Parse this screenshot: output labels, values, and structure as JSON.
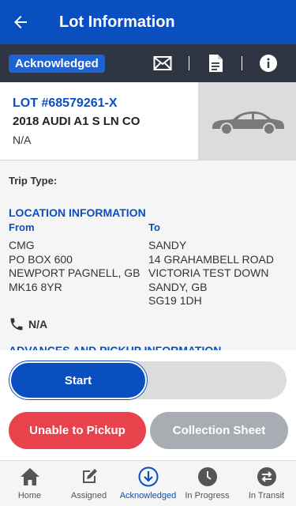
{
  "header": {
    "title": "Lot Information",
    "back_icon": "arrow-left-icon"
  },
  "status_bar": {
    "badge": "Acknowledged",
    "icons": [
      "mail-icon",
      "document-icon",
      "info-icon"
    ]
  },
  "lot": {
    "number": "LOT #68579261-X",
    "vehicle": "2018 AUDI A1 S LN CO",
    "secondary": "N/A",
    "image_icon": "car-icon"
  },
  "details": {
    "trip_type_label": "Trip Type:",
    "location_heading": "LOCATION INFORMATION",
    "from": {
      "label": "From",
      "lines": [
        "CMG",
        "PO BOX 600",
        "NEWPORT PAGNELL, GB",
        "MK16 8YR"
      ]
    },
    "to": {
      "label": "To",
      "lines": [
        "SANDY",
        "14 GRAHAMBELL ROAD",
        "VICTORIA TEST DOWN",
        "SANDY, GB",
        "SG19 1DH"
      ]
    },
    "phone": "N/A",
    "advances_heading": "ADVANCES AND PICKUP INFORMATION"
  },
  "actions": {
    "start": "Start",
    "unable": "Unable to Pickup",
    "collection": "Collection Sheet"
  },
  "tabs": [
    {
      "label": "Home",
      "icon": "home-icon",
      "active": false
    },
    {
      "label": "Assigned",
      "icon": "edit-icon",
      "active": false
    },
    {
      "label": "Acknowledged",
      "icon": "arrow-down-circle-icon",
      "active": true
    },
    {
      "label": "In Progress",
      "icon": "clock-icon",
      "active": false
    },
    {
      "label": "In Transit",
      "icon": "swap-icon",
      "active": false
    }
  ],
  "colors": {
    "primary": "#0a4fc0",
    "dark_bar": "#2f3542",
    "danger": "#e8424c",
    "disabled": "#a8adb4"
  }
}
